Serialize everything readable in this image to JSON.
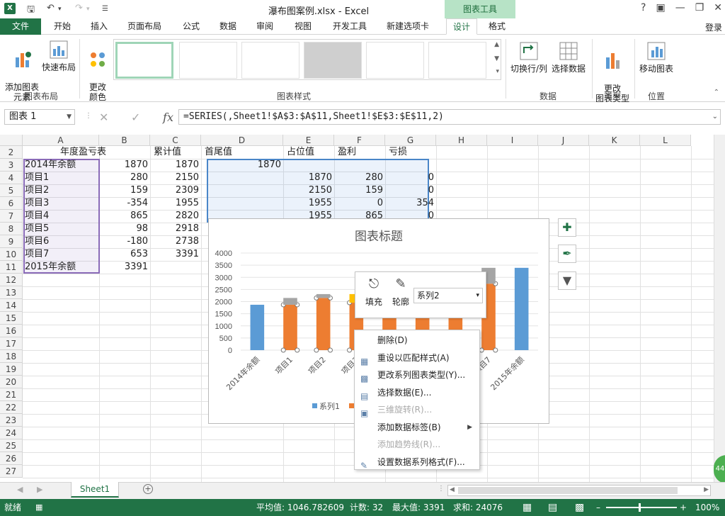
{
  "window": {
    "title": "瀑布图案例.xlsx - Excel",
    "context_tab_group": "图表工具",
    "login": "登录",
    "help": "?",
    "app_icon": "X"
  },
  "tabs": [
    "文件",
    "开始",
    "插入",
    "页面布局",
    "公式",
    "数据",
    "审阅",
    "视图",
    "开发工具",
    "新建选项卡",
    "设计",
    "格式"
  ],
  "active_tab": "设计",
  "ribbon": {
    "add_element": "添加图表\n元素",
    "quick_layout": "快速布局",
    "change_color": "更改\n颜色",
    "switch_row_col": "切换行/列",
    "select_data": "选择数据",
    "change_type": "更改\n图表类型",
    "move_chart": "移动图表",
    "group_layout": "图表布局",
    "group_styles": "图表样式",
    "group_data": "数据",
    "group_type": "类型",
    "group_location": "位置"
  },
  "formula_bar": {
    "name_box": "图表 1",
    "formula": "=SERIES(,Sheet1!$A$3:$A$11,Sheet1!$E$3:$E$11,2)",
    "fx": "fx"
  },
  "columns": [
    "A",
    "B",
    "C",
    "D",
    "E",
    "F",
    "G",
    "H",
    "I",
    "J",
    "K",
    "L"
  ],
  "rows": [
    "2",
    "3",
    "4",
    "5",
    "6",
    "7",
    "8",
    "9",
    "10",
    "11",
    "12",
    "13",
    "14",
    "15",
    "16",
    "17",
    "18",
    "19",
    "20",
    "21",
    "22",
    "23",
    "24",
    "25",
    "26",
    "27"
  ],
  "headers": {
    "a": "年度盈亏表",
    "c": "累计值",
    "d": "首尾值",
    "e": "占位值",
    "f": "盈利",
    "g": "亏损"
  },
  "table_rows": [
    {
      "a": "2014年余额",
      "b": "1870",
      "c": "1870",
      "d": "1870",
      "e": "",
      "f": "",
      "g": ""
    },
    {
      "a": "项目1",
      "b": "280",
      "c": "2150",
      "d": "",
      "e": "1870",
      "f": "280",
      "g": "0"
    },
    {
      "a": "项目2",
      "b": "159",
      "c": "2309",
      "d": "",
      "e": "2150",
      "f": "159",
      "g": "0"
    },
    {
      "a": "项目3",
      "b": "-354",
      "c": "1955",
      "d": "",
      "e": "1955",
      "f": "0",
      "g": "354"
    },
    {
      "a": "项目4",
      "b": "865",
      "c": "2820",
      "d": "",
      "e": "1955",
      "f": "865",
      "g": "0"
    },
    {
      "a": "项目5",
      "b": "98",
      "c": "2918",
      "d": "",
      "e": "",
      "f": "",
      "g": ""
    },
    {
      "a": "项目6",
      "b": "-180",
      "c": "2738",
      "d": "",
      "e": "",
      "f": "",
      "g": ""
    },
    {
      "a": "项目7",
      "b": "653",
      "c": "3391",
      "d": "",
      "e": "",
      "f": "",
      "g": ""
    },
    {
      "a": "2015年余额",
      "b": "3391",
      "c": "",
      "d": "",
      "e": "",
      "f": "",
      "g": ""
    }
  ],
  "chart_data": {
    "type": "bar",
    "title": "图表标题",
    "categories": [
      "2014年余额",
      "项目1",
      "项目2",
      "项目3",
      "项目4",
      "项目5",
      "项目6",
      "项目7",
      "2015年余额"
    ],
    "series": [
      {
        "name": "系列1",
        "values": [
          1870,
          0,
          0,
          0,
          0,
          0,
          0,
          0,
          3391
        ],
        "color": "#5b9bd5"
      },
      {
        "name": "系列2",
        "values": [
          0,
          1870,
          2150,
          1955,
          1955,
          2820,
          2738,
          2738,
          0
        ],
        "color": "#ed7d31"
      },
      {
        "name": "系列3",
        "values": [
          0,
          280,
          159,
          0,
          865,
          98,
          0,
          653,
          0
        ],
        "color": "#a5a5a5"
      },
      {
        "name": "系列4",
        "values": [
          0,
          0,
          0,
          354,
          0,
          0,
          180,
          0,
          0
        ],
        "color": "#ffc000"
      }
    ],
    "ylim": [
      0,
      4000
    ],
    "yticks": [
      "4000",
      "3500",
      "3000",
      "2500",
      "2000",
      "1500",
      "1000",
      "500",
      "0"
    ],
    "legend_position": "bottom",
    "grid": true
  },
  "mini_toolbar": {
    "fill": "填充",
    "outline": "轮廓",
    "series_select": "系列2"
  },
  "context_menu": [
    {
      "label": "删除(D)",
      "disabled": false
    },
    {
      "label": "重设以匹配样式(A)",
      "disabled": false
    },
    {
      "label": "更改系列图表类型(Y)...",
      "disabled": false
    },
    {
      "label": "选择数据(E)...",
      "disabled": false
    },
    {
      "label": "三维旋转(R)...",
      "disabled": true
    },
    {
      "label": "添加数据标签(B)",
      "disabled": false,
      "submenu": true
    },
    {
      "label": "添加趋势线(R)...",
      "disabled": true
    },
    {
      "label": "设置数据系列格式(F)...",
      "disabled": false
    }
  ],
  "sheet": {
    "name": "Sheet1"
  },
  "status": {
    "mode": "就绪",
    "average": "平均值: 1046.782609",
    "count": "计数: 32",
    "max": "最大值: 3391",
    "sum": "求和: 24076",
    "zoom": "100%"
  },
  "colors": {
    "excel_green": "#217346",
    "accent_blue": "#5b9bd5",
    "accent_orange": "#ed7d31"
  }
}
